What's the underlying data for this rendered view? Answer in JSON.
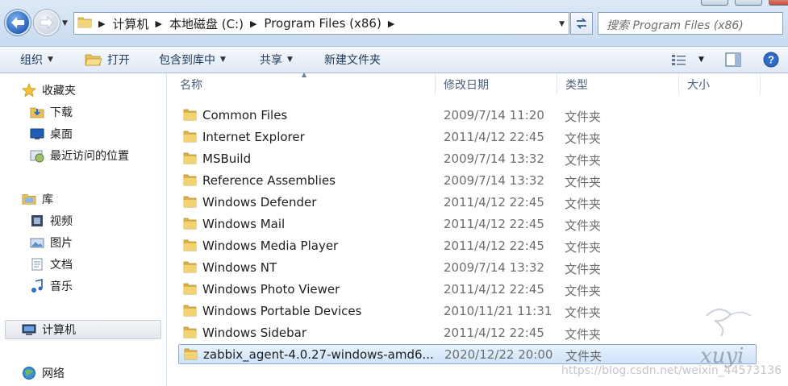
{
  "breadcrumb": {
    "items": [
      "计算机",
      "本地磁盘 (C:)",
      "Program Files (x86)"
    ]
  },
  "search": {
    "placeholder": "搜索 Program Files (x86)"
  },
  "toolbar": {
    "organize": "组织",
    "open": "打开",
    "include_library": "包含到库中",
    "share": "共享",
    "new_folder": "新建文件夹"
  },
  "nav": {
    "favorites": "收藏夹",
    "downloads": "下载",
    "desktop": "桌面",
    "recent": "最近访问的位置",
    "libraries": "库",
    "videos": "视频",
    "pictures": "图片",
    "documents": "文档",
    "music": "音乐",
    "computer": "计算机",
    "network": "网络"
  },
  "columns": {
    "name": "名称",
    "modified": "修改日期",
    "type": "类型",
    "size": "大小"
  },
  "files": [
    {
      "name": "Common Files",
      "date": "2009/7/14 11:20",
      "type": "文件夹"
    },
    {
      "name": "Internet Explorer",
      "date": "2011/4/12 22:45",
      "type": "文件夹"
    },
    {
      "name": "MSBuild",
      "date": "2009/7/14 13:32",
      "type": "文件夹"
    },
    {
      "name": "Reference Assemblies",
      "date": "2009/7/14 13:32",
      "type": "文件夹"
    },
    {
      "name": "Windows Defender",
      "date": "2011/4/12 22:45",
      "type": "文件夹"
    },
    {
      "name": "Windows Mail",
      "date": "2011/4/12 22:45",
      "type": "文件夹"
    },
    {
      "name": "Windows Media Player",
      "date": "2011/4/12 22:45",
      "type": "文件夹"
    },
    {
      "name": "Windows NT",
      "date": "2009/7/14 13:32",
      "type": "文件夹"
    },
    {
      "name": "Windows Photo Viewer",
      "date": "2011/4/12 22:45",
      "type": "文件夹"
    },
    {
      "name": "Windows Portable Devices",
      "date": "2010/11/21 11:31",
      "type": "文件夹"
    },
    {
      "name": "Windows Sidebar",
      "date": "2011/4/12 22:45",
      "type": "文件夹"
    },
    {
      "name": "zabbix_agent-4.0.27-windows-amd6...",
      "date": "2020/12/22 20:00",
      "type": "文件夹"
    }
  ],
  "watermark": {
    "signature": "xuyi",
    "url": "https://blog.csdn.net/weixin_44573136"
  },
  "colors": {
    "selection": "#cfe3fa",
    "selection_border": "#84acdd",
    "folder": "#e8c15a",
    "toolbar_text": "#1e395b"
  }
}
